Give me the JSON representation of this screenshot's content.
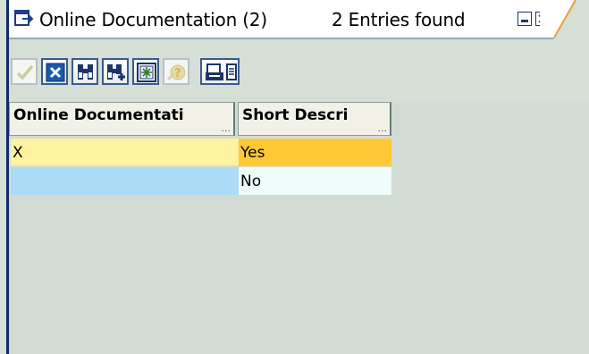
{
  "window": {
    "title": "Online Documentation (2)",
    "entries": "2 Entries found",
    "minimize_icon": "minimize-icon",
    "close_icon": "close-icon"
  },
  "toolbar": {
    "buttons": [
      {
        "name": "continue",
        "icon": "checkmark-icon",
        "enabled": false
      },
      {
        "name": "cancel",
        "icon": "x-icon",
        "enabled": true
      },
      {
        "name": "find",
        "icon": "binoculars-icon",
        "enabled": true
      },
      {
        "name": "find-next",
        "icon": "binoculars-plus-icon",
        "enabled": true
      },
      {
        "name": "new-selection",
        "icon": "new-selection-icon",
        "enabled": true
      },
      {
        "name": "help",
        "icon": "help-icon",
        "enabled": false
      },
      {
        "name": "print",
        "icon": "printer-icon",
        "enabled": true
      }
    ]
  },
  "table": {
    "columns": [
      "Online Documentati",
      "Short Descri"
    ],
    "column_more": "...",
    "rows": [
      [
        "X",
        "Yes"
      ],
      [
        "",
        "No"
      ]
    ]
  },
  "colors": {
    "frame_accent": "#0e2a6c",
    "row1_col1": "#fff2a0",
    "row1_col2_selected": "#ffc935",
    "row2_col1": "#acdcf5",
    "row2_col2": "#effdfd"
  }
}
